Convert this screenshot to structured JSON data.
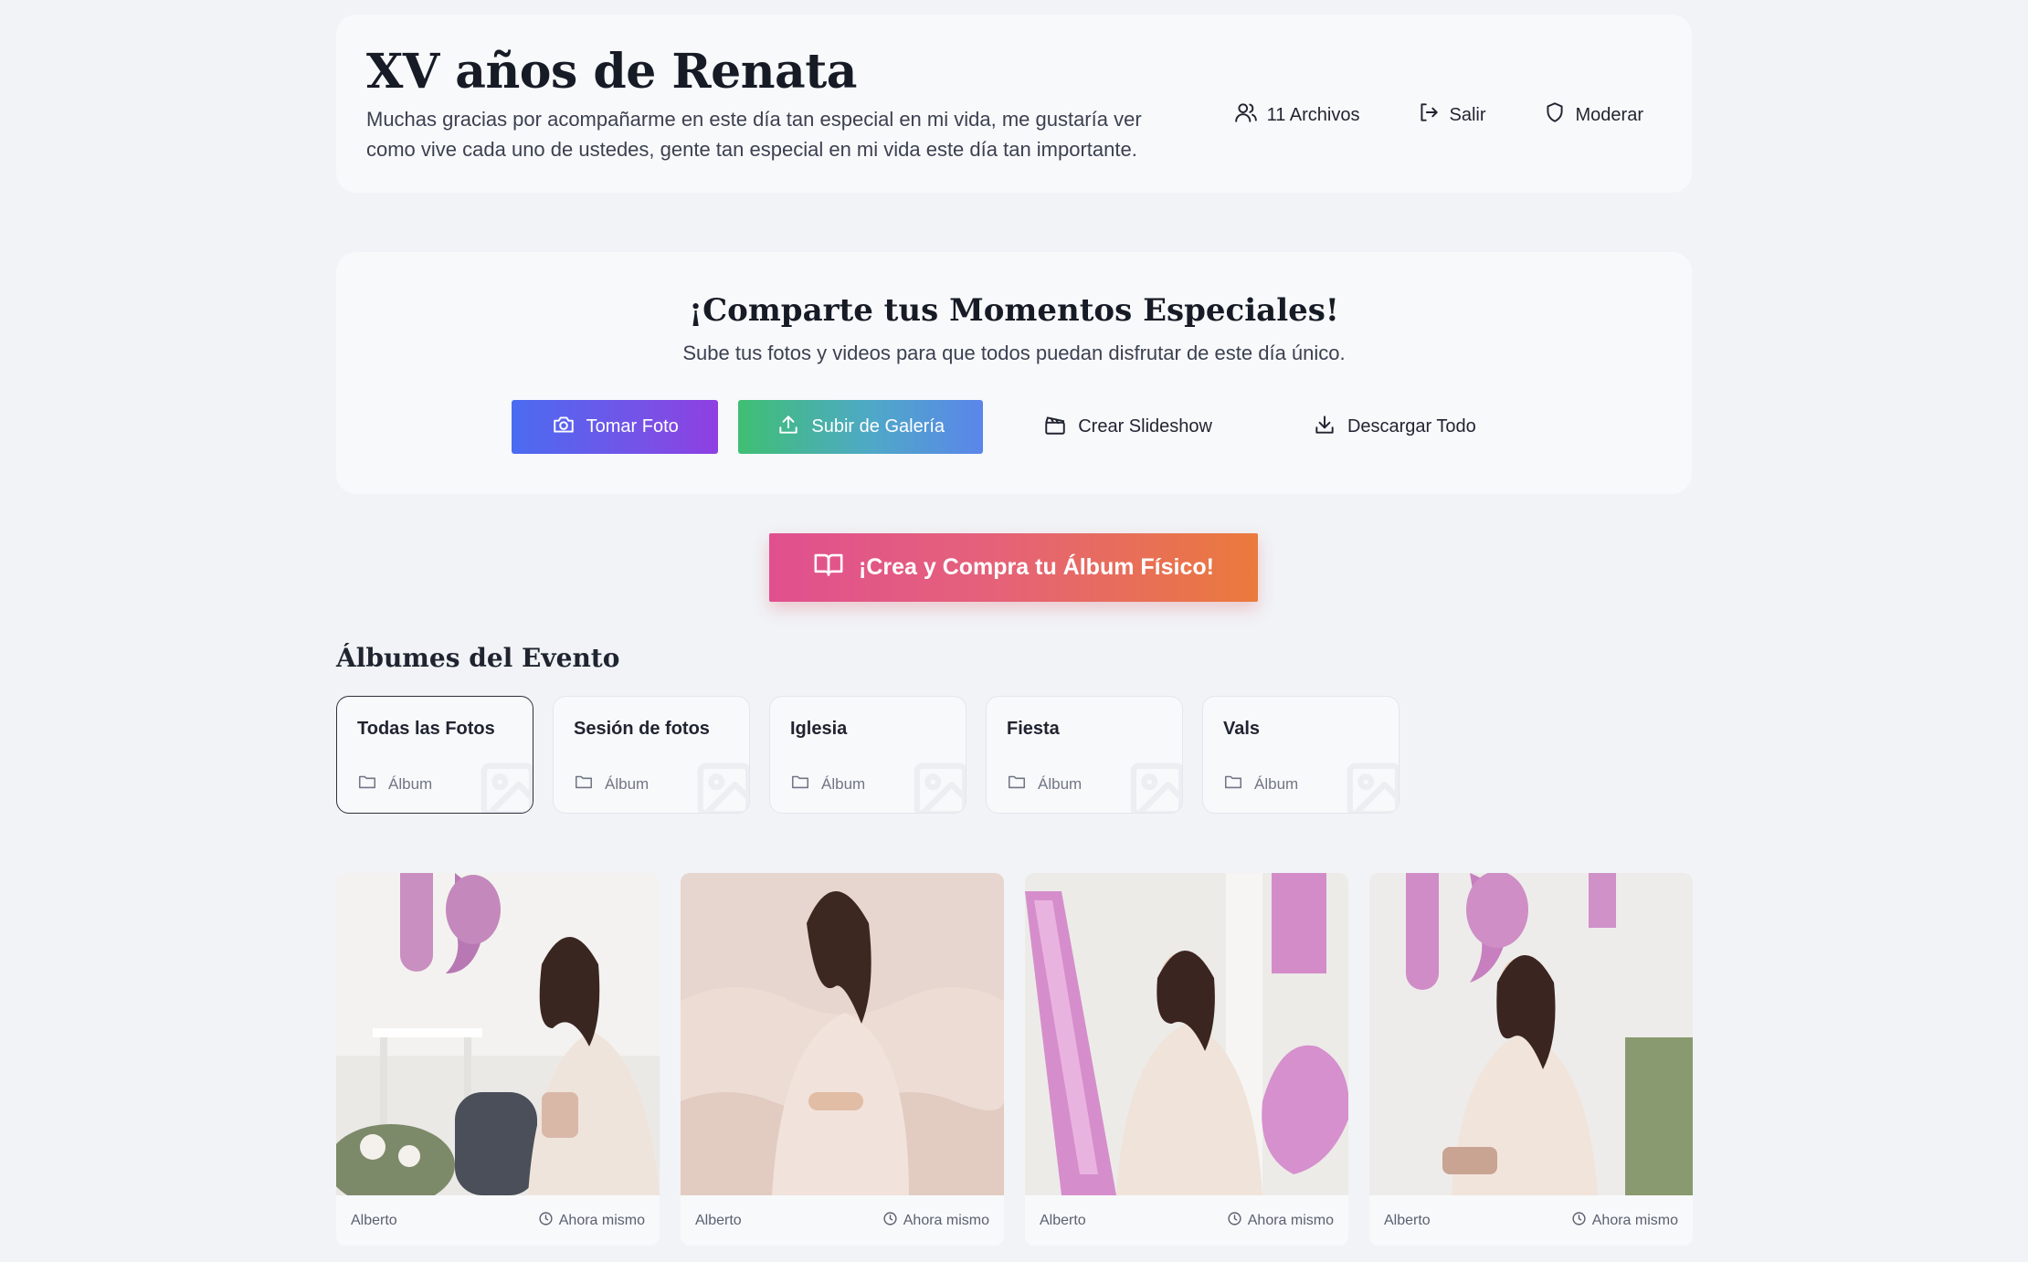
{
  "header": {
    "title": "XV años de Renata",
    "description": "Muchas gracias por acompañarme en este día tan especial en mi vida, me gustaría ver como vive cada uno de ustedes, gente tan especial en mi vida este día tan importante.",
    "actions": {
      "files_label": "11 Archivos",
      "logout_label": "Salir",
      "moderate_label": "Moderar"
    }
  },
  "upload": {
    "title": "¡Comparte tus Momentos Especiales!",
    "subtitle": "Sube tus fotos y videos para que todos puedan disfrutar de este día único.",
    "take_photo_label": "Tomar Foto",
    "upload_gallery_label": "Subir de Galería",
    "slideshow_label": "Crear Slideshow",
    "download_all_label": "Descargar Todo"
  },
  "album_cta": {
    "label": "¡Crea y Compra tu Álbum Físico!"
  },
  "albums": {
    "section_title": "Álbumes del Evento",
    "items": [
      {
        "name": "Todas las Fotos",
        "type": "Álbum",
        "active": true
      },
      {
        "name": "Sesión de fotos",
        "type": "Álbum",
        "active": false
      },
      {
        "name": "Iglesia",
        "type": "Álbum",
        "active": false
      },
      {
        "name": "Fiesta",
        "type": "Álbum",
        "active": false
      },
      {
        "name": "Vals",
        "type": "Álbum",
        "active": false
      }
    ]
  },
  "photos": [
    {
      "author": "Alberto",
      "time": "Ahora mismo"
    },
    {
      "author": "Alberto",
      "time": "Ahora mismo"
    },
    {
      "author": "Alberto",
      "time": "Ahora mismo"
    },
    {
      "author": "Alberto",
      "time": "Ahora mismo"
    }
  ],
  "colors": {
    "background": "#f1f3f6",
    "card": "#f8f9fb",
    "take_photo_gradient": [
      "#4a6cf0",
      "#8f3fe2"
    ],
    "gallery_gradient": [
      "#3fbf73",
      "#5a86ea"
    ],
    "album_cta_gradient": [
      "#e0508f",
      "#ea7a3c"
    ]
  }
}
